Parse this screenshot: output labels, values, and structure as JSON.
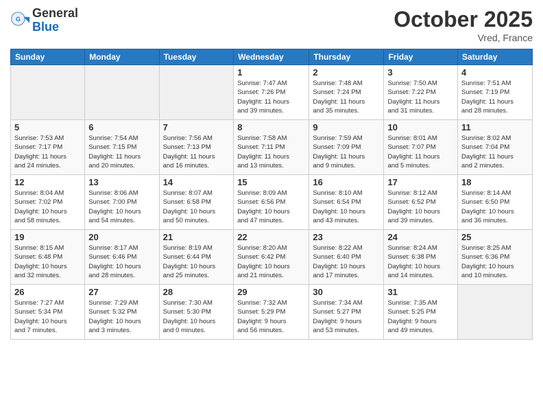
{
  "header": {
    "logo_general": "General",
    "logo_blue": "Blue",
    "month_title": "October 2025",
    "location": "Vred, France"
  },
  "weekdays": [
    "Sunday",
    "Monday",
    "Tuesday",
    "Wednesday",
    "Thursday",
    "Friday",
    "Saturday"
  ],
  "weeks": [
    [
      {
        "day": "",
        "info": ""
      },
      {
        "day": "",
        "info": ""
      },
      {
        "day": "",
        "info": ""
      },
      {
        "day": "1",
        "info": "Sunrise: 7:47 AM\nSunset: 7:26 PM\nDaylight: 11 hours\nand 39 minutes."
      },
      {
        "day": "2",
        "info": "Sunrise: 7:48 AM\nSunset: 7:24 PM\nDaylight: 11 hours\nand 35 minutes."
      },
      {
        "day": "3",
        "info": "Sunrise: 7:50 AM\nSunset: 7:22 PM\nDaylight: 11 hours\nand 31 minutes."
      },
      {
        "day": "4",
        "info": "Sunrise: 7:51 AM\nSunset: 7:19 PM\nDaylight: 11 hours\nand 28 minutes."
      }
    ],
    [
      {
        "day": "5",
        "info": "Sunrise: 7:53 AM\nSunset: 7:17 PM\nDaylight: 11 hours\nand 24 minutes."
      },
      {
        "day": "6",
        "info": "Sunrise: 7:54 AM\nSunset: 7:15 PM\nDaylight: 11 hours\nand 20 minutes."
      },
      {
        "day": "7",
        "info": "Sunrise: 7:56 AM\nSunset: 7:13 PM\nDaylight: 11 hours\nand 16 minutes."
      },
      {
        "day": "8",
        "info": "Sunrise: 7:58 AM\nSunset: 7:11 PM\nDaylight: 11 hours\nand 13 minutes."
      },
      {
        "day": "9",
        "info": "Sunrise: 7:59 AM\nSunset: 7:09 PM\nDaylight: 11 hours\nand 9 minutes."
      },
      {
        "day": "10",
        "info": "Sunrise: 8:01 AM\nSunset: 7:07 PM\nDaylight: 11 hours\nand 5 minutes."
      },
      {
        "day": "11",
        "info": "Sunrise: 8:02 AM\nSunset: 7:04 PM\nDaylight: 11 hours\nand 2 minutes."
      }
    ],
    [
      {
        "day": "12",
        "info": "Sunrise: 8:04 AM\nSunset: 7:02 PM\nDaylight: 10 hours\nand 58 minutes."
      },
      {
        "day": "13",
        "info": "Sunrise: 8:06 AM\nSunset: 7:00 PM\nDaylight: 10 hours\nand 54 minutes."
      },
      {
        "day": "14",
        "info": "Sunrise: 8:07 AM\nSunset: 6:58 PM\nDaylight: 10 hours\nand 50 minutes."
      },
      {
        "day": "15",
        "info": "Sunrise: 8:09 AM\nSunset: 6:56 PM\nDaylight: 10 hours\nand 47 minutes."
      },
      {
        "day": "16",
        "info": "Sunrise: 8:10 AM\nSunset: 6:54 PM\nDaylight: 10 hours\nand 43 minutes."
      },
      {
        "day": "17",
        "info": "Sunrise: 8:12 AM\nSunset: 6:52 PM\nDaylight: 10 hours\nand 39 minutes."
      },
      {
        "day": "18",
        "info": "Sunrise: 8:14 AM\nSunset: 6:50 PM\nDaylight: 10 hours\nand 36 minutes."
      }
    ],
    [
      {
        "day": "19",
        "info": "Sunrise: 8:15 AM\nSunset: 6:48 PM\nDaylight: 10 hours\nand 32 minutes."
      },
      {
        "day": "20",
        "info": "Sunrise: 8:17 AM\nSunset: 6:46 PM\nDaylight: 10 hours\nand 28 minutes."
      },
      {
        "day": "21",
        "info": "Sunrise: 8:19 AM\nSunset: 6:44 PM\nDaylight: 10 hours\nand 25 minutes."
      },
      {
        "day": "22",
        "info": "Sunrise: 8:20 AM\nSunset: 6:42 PM\nDaylight: 10 hours\nand 21 minutes."
      },
      {
        "day": "23",
        "info": "Sunrise: 8:22 AM\nSunset: 6:40 PM\nDaylight: 10 hours\nand 17 minutes."
      },
      {
        "day": "24",
        "info": "Sunrise: 8:24 AM\nSunset: 6:38 PM\nDaylight: 10 hours\nand 14 minutes."
      },
      {
        "day": "25",
        "info": "Sunrise: 8:25 AM\nSunset: 6:36 PM\nDaylight: 10 hours\nand 10 minutes."
      }
    ],
    [
      {
        "day": "26",
        "info": "Sunrise: 7:27 AM\nSunset: 5:34 PM\nDaylight: 10 hours\nand 7 minutes."
      },
      {
        "day": "27",
        "info": "Sunrise: 7:29 AM\nSunset: 5:32 PM\nDaylight: 10 hours\nand 3 minutes."
      },
      {
        "day": "28",
        "info": "Sunrise: 7:30 AM\nSunset: 5:30 PM\nDaylight: 10 hours\nand 0 minutes."
      },
      {
        "day": "29",
        "info": "Sunrise: 7:32 AM\nSunset: 5:29 PM\nDaylight: 9 hours\nand 56 minutes."
      },
      {
        "day": "30",
        "info": "Sunrise: 7:34 AM\nSunset: 5:27 PM\nDaylight: 9 hours\nand 53 minutes."
      },
      {
        "day": "31",
        "info": "Sunrise: 7:35 AM\nSunset: 5:25 PM\nDaylight: 9 hours\nand 49 minutes."
      },
      {
        "day": "",
        "info": ""
      }
    ]
  ]
}
